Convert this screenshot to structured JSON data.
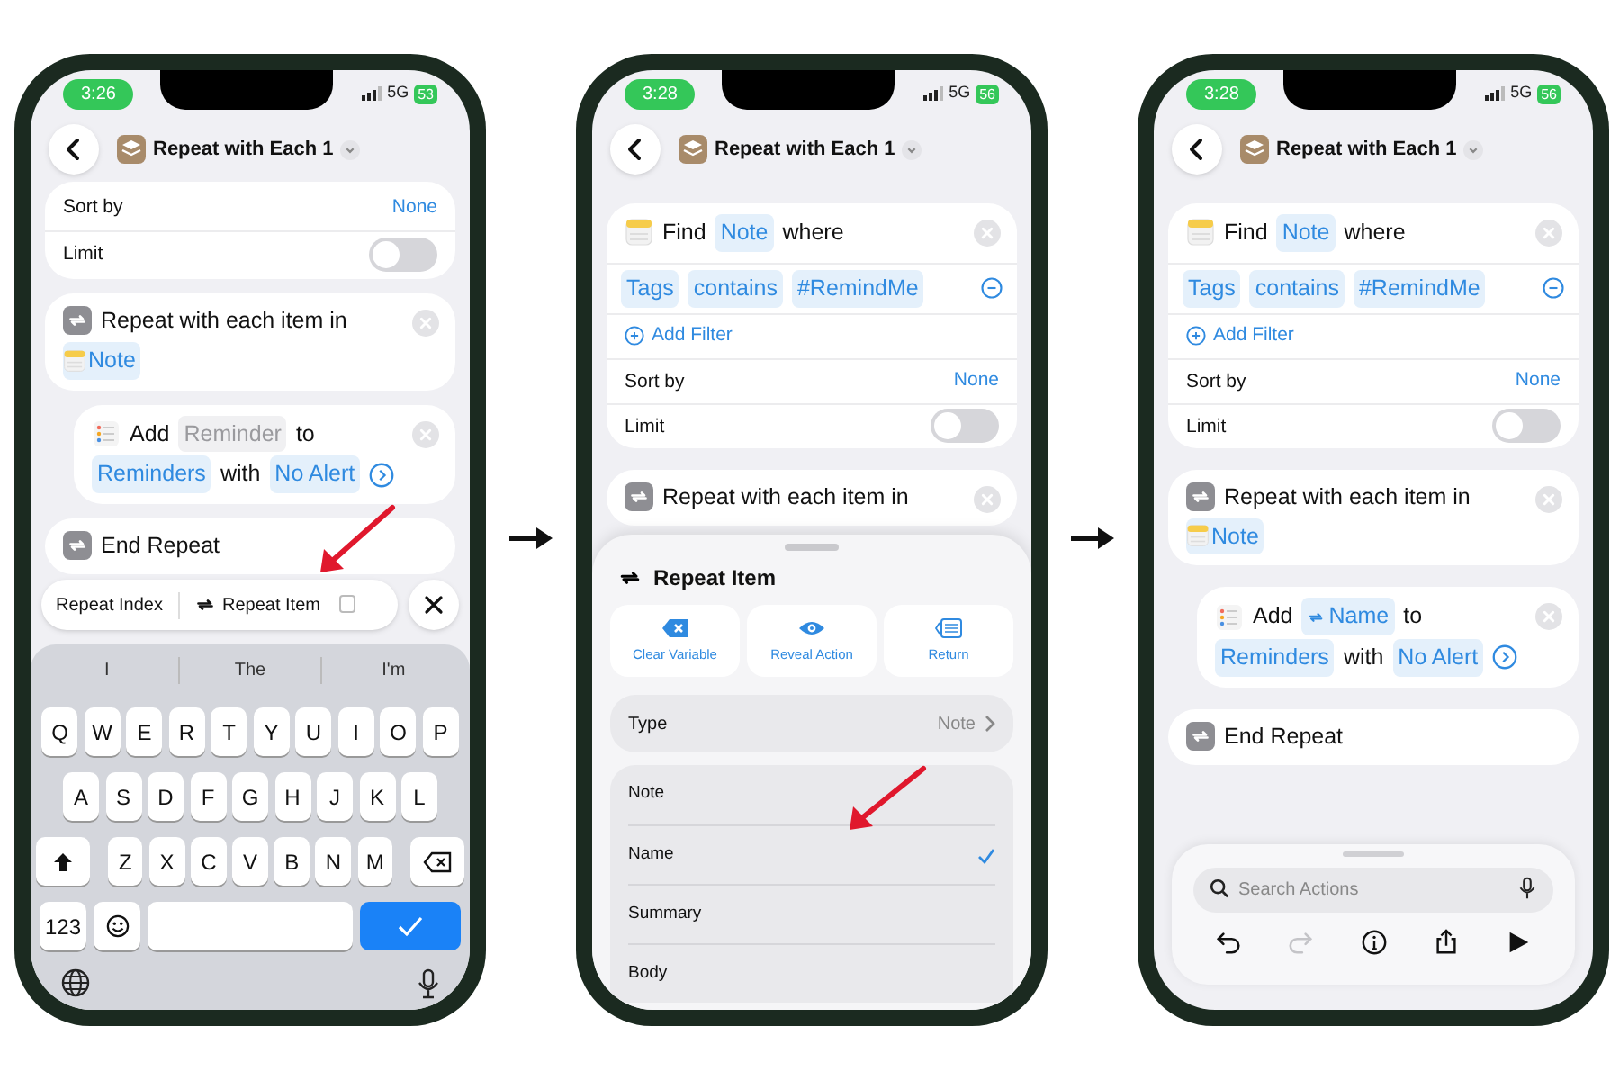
{
  "phones": [
    {
      "status": {
        "time": "3:26",
        "network": "5G",
        "battery": "53"
      },
      "title": "Repeat with Each 1",
      "actions": [
        {
          "kind": "options",
          "rows": [
            {
              "kind": "value",
              "label": "Sort by",
              "value": "None"
            },
            {
              "kind": "toggle",
              "label": "Limit",
              "on": false
            }
          ]
        },
        {
          "kind": "repeat",
          "lines": [
            [
              {
                "kind": "plain",
                "text": "Repeat with each item in"
              }
            ],
            [
              {
                "kind": "note",
                "text": "Note"
              }
            ]
          ],
          "children": [
            {
              "kind": "add",
              "lines": [
                [
                  {
                    "kind": "plain",
                    "text": "Add"
                  },
                  {
                    "kind": "placeholder",
                    "text": "Reminder"
                  },
                  {
                    "kind": "plain",
                    "text": "to"
                  }
                ],
                [
                  {
                    "kind": "token",
                    "text": "Reminders"
                  },
                  {
                    "kind": "plain",
                    "text": "with"
                  },
                  {
                    "kind": "token",
                    "text": "No Alert"
                  }
                ]
              ]
            }
          ]
        },
        {
          "kind": "end",
          "lines": [
            [
              {
                "kind": "plain",
                "text": "End Repeat"
              }
            ]
          ]
        }
      ],
      "suggestions": {
        "items": [
          {
            "kind": "plain",
            "label": "Repeat Index"
          },
          {
            "kind": "variable",
            "label": "Repeat Item"
          }
        ]
      },
      "keyboard": {
        "predictions": [
          "I",
          "The",
          "I'm"
        ],
        "rows": [
          [
            "Q",
            "W",
            "E",
            "R",
            "T",
            "Y",
            "U",
            "I",
            "O",
            "P"
          ],
          [
            "A",
            "S",
            "D",
            "F",
            "G",
            "H",
            "J",
            "K",
            "L"
          ],
          [
            "Z",
            "X",
            "C",
            "V",
            "B",
            "N",
            "M"
          ]
        ],
        "numbers_key": "123"
      }
    },
    {
      "status": {
        "time": "3:28",
        "network": "5G",
        "battery": "56"
      },
      "title": "Repeat with Each 1",
      "actions": [
        {
          "kind": "find",
          "lines": [
            [
              {
                "kind": "plain",
                "text": "Find"
              },
              {
                "kind": "token",
                "text": "Note"
              },
              {
                "kind": "plain",
                "text": "where"
              }
            ]
          ],
          "filters": [
            [
              {
                "kind": "token",
                "text": "Tags"
              },
              {
                "kind": "token",
                "text": "contains"
              },
              {
                "kind": "token",
                "text": "#RemindMe"
              }
            ]
          ],
          "add_filter": "Add Filter",
          "rows": [
            {
              "kind": "value",
              "label": "Sort by",
              "value": "None"
            },
            {
              "kind": "toggle",
              "label": "Limit",
              "on": false
            }
          ]
        },
        {
          "kind": "repeat",
          "lines": [
            [
              {
                "kind": "plain",
                "text": "Repeat with each item in"
              }
            ]
          ]
        }
      ],
      "sheet": {
        "title": "Repeat Item",
        "actions": [
          {
            "kind": "clear",
            "label": "Clear Variable"
          },
          {
            "kind": "reveal",
            "label": "Reveal Action"
          },
          {
            "kind": "return",
            "label": "Return"
          }
        ],
        "type_row": {
          "label": "Type",
          "value": "Note"
        },
        "options": [
          {
            "label": "Note",
            "selected": false
          },
          {
            "label": "Name",
            "selected": true
          },
          {
            "label": "Summary",
            "selected": false
          },
          {
            "label": "Body",
            "selected": false
          }
        ]
      }
    },
    {
      "status": {
        "time": "3:28",
        "network": "5G",
        "battery": "56"
      },
      "title": "Repeat with Each 1",
      "actions": [
        {
          "kind": "find",
          "lines": [
            [
              {
                "kind": "plain",
                "text": "Find"
              },
              {
                "kind": "token",
                "text": "Note"
              },
              {
                "kind": "plain",
                "text": "where"
              }
            ]
          ],
          "filters": [
            [
              {
                "kind": "token",
                "text": "Tags"
              },
              {
                "kind": "token",
                "text": "contains"
              },
              {
                "kind": "token",
                "text": "#RemindMe"
              }
            ]
          ],
          "add_filter": "Add Filter",
          "rows": [
            {
              "kind": "value",
              "label": "Sort by",
              "value": "None"
            },
            {
              "kind": "toggle",
              "label": "Limit",
              "on": false
            }
          ]
        },
        {
          "kind": "repeat",
          "lines": [
            [
              {
                "kind": "plain",
                "text": "Repeat with each item in"
              }
            ],
            [
              {
                "kind": "note",
                "text": "Note"
              }
            ]
          ],
          "children": [
            {
              "kind": "add",
              "lines": [
                [
                  {
                    "kind": "plain",
                    "text": "Add"
                  },
                  {
                    "kind": "variable",
                    "text": "Name"
                  },
                  {
                    "kind": "plain",
                    "text": "to"
                  }
                ],
                [
                  {
                    "kind": "token",
                    "text": "Reminders"
                  },
                  {
                    "kind": "plain",
                    "text": "with"
                  },
                  {
                    "kind": "token",
                    "text": "No Alert"
                  }
                ]
              ]
            }
          ]
        },
        {
          "kind": "end",
          "lines": [
            [
              {
                "kind": "plain",
                "text": "End Repeat"
              }
            ]
          ]
        }
      ],
      "toolbar": {
        "search": {
          "placeholder": "Search Actions"
        },
        "tools": [
          {
            "kind": "undo",
            "disabled": false
          },
          {
            "kind": "redo",
            "disabled": true
          },
          {
            "kind": "info",
            "disabled": false
          },
          {
            "kind": "share",
            "disabled": false
          },
          {
            "kind": "run",
            "disabled": false
          }
        ]
      }
    }
  ]
}
